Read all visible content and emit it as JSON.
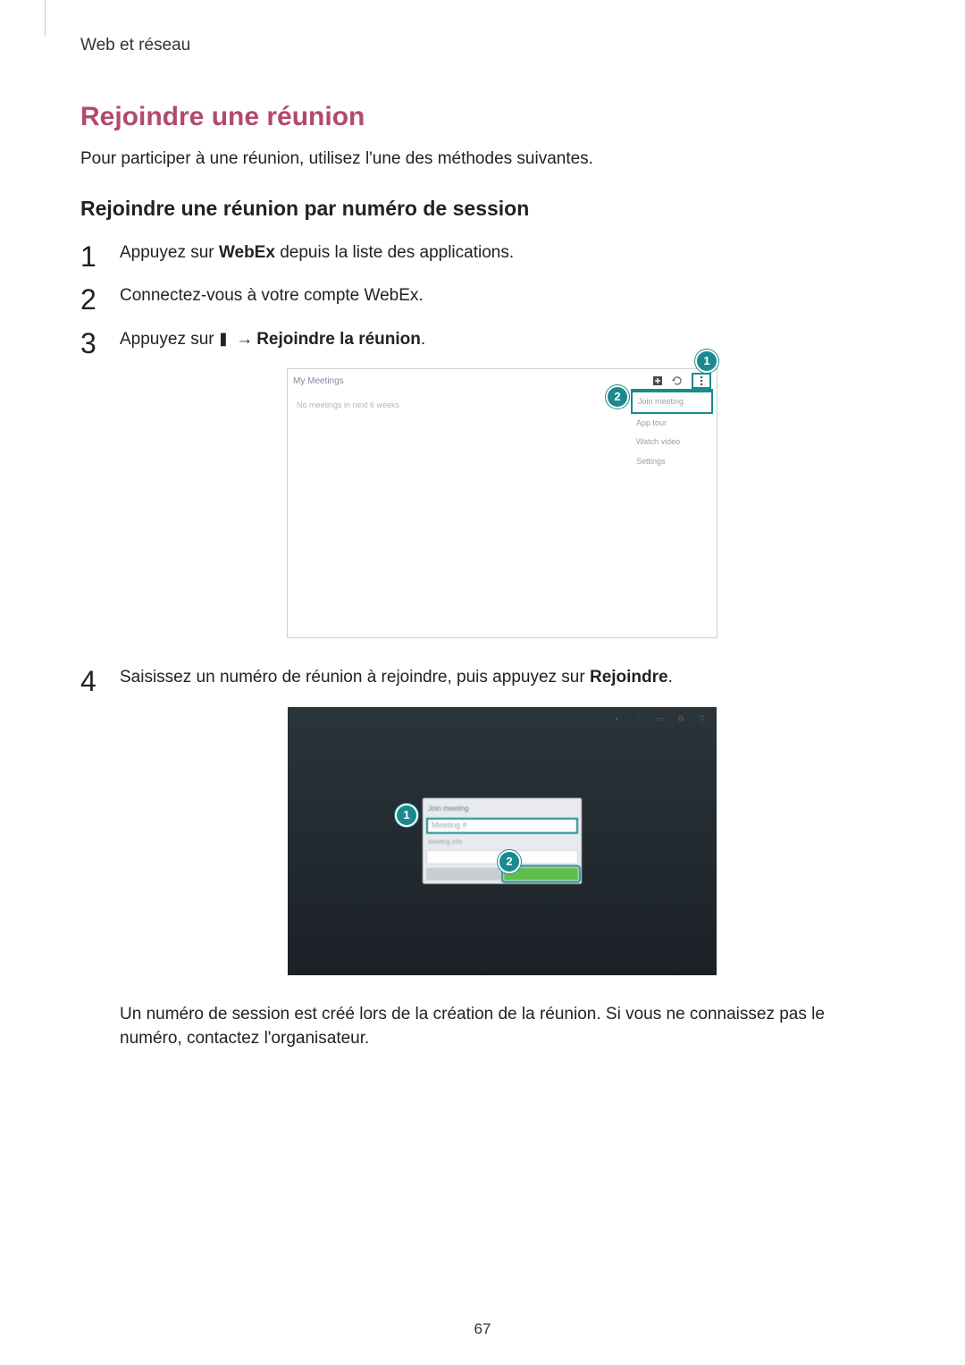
{
  "breadcrumb": "Web et réseau",
  "section_title": "Rejoindre une réunion",
  "intro": "Pour participer à une réunion, utilisez l'une des méthodes suivantes.",
  "subsection": "Rejoindre une réunion par numéro de session",
  "steps": {
    "s1a": "Appuyez sur ",
    "s1_bold": "WebEx",
    "s1b": " depuis la liste des applications.",
    "s2": "Connectez-vous à votre compte WebEx.",
    "s3a": "Appuyez sur ",
    "s3_arrow": "→",
    "s3_bold": "Rejoindre la réunion",
    "s3b": ".",
    "s4a": "Saisissez un numéro de réunion à rejoindre, puis appuyez sur ",
    "s4_bold": "Rejoindre",
    "s4b": "."
  },
  "note": "Un numéro de session est créé lors de la création de la réunion. Si vous ne connaissez pas le numéro, contactez l'organisateur.",
  "page_number": "67",
  "shot1": {
    "title": "My Meetings",
    "empty": "No meetings in next 6 weeks",
    "menu": [
      "Join meeting",
      "App tour",
      "Watch video",
      "Settings"
    ],
    "callout1": "1",
    "callout2": "2"
  },
  "shot2": {
    "dialog_title": "Join meeting",
    "field1_placeholder": "Meeting #",
    "helper": "Meeting info",
    "callout1": "1",
    "callout2": "2"
  }
}
